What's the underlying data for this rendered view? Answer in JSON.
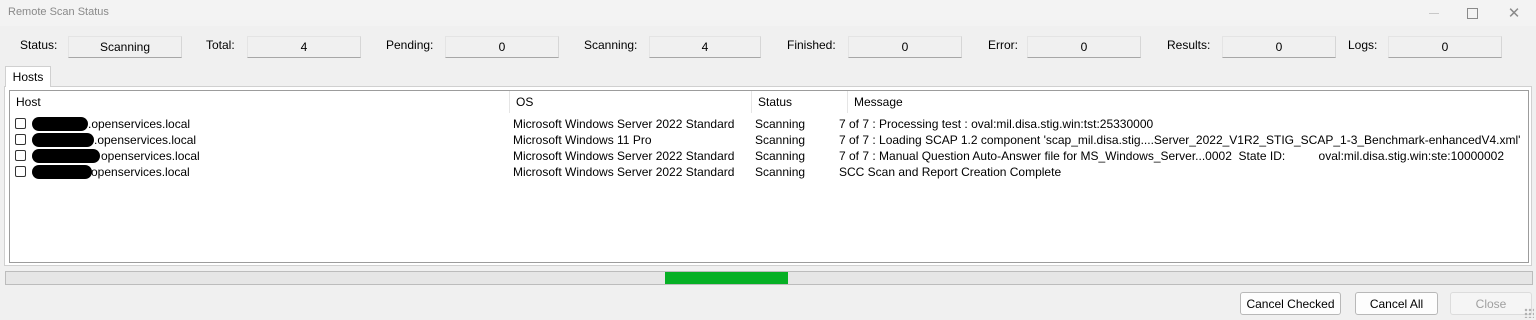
{
  "window": {
    "title": "Remote Scan Status",
    "controls": [
      "minimize-icon",
      "maximize-icon",
      "close-icon"
    ]
  },
  "stats": [
    {
      "label": "Status:",
      "value": "Scanning"
    },
    {
      "label": "Total:",
      "value": "4"
    },
    {
      "label": "Pending:",
      "value": "0"
    },
    {
      "label": "Scanning:",
      "value": "4"
    },
    {
      "label": "Finished:",
      "value": "0"
    },
    {
      "label": "Error:",
      "value": "0"
    },
    {
      "label": "Results:",
      "value": "0"
    },
    {
      "label": "Logs:",
      "value": "0"
    }
  ],
  "tab": {
    "label": "Hosts"
  },
  "table": {
    "headers": [
      "Host",
      "OS",
      "Status",
      "Message"
    ],
    "rows": [
      {
        "checked": false,
        "host": ".openservices.local",
        "os": "Microsoft Windows Server 2022 Standard",
        "status": "Scanning",
        "message": "7 of 7 : Processing test : oval:mil.disa.stig.win:tst:25330000"
      },
      {
        "checked": false,
        "host": ".openservices.local",
        "os": "Microsoft Windows 11 Pro",
        "status": "Scanning",
        "message": "7 of 7 : Loading SCAP 1.2 component 'scap_mil.disa.stig....Server_2022_V1R2_STIG_SCAP_1-3_Benchmark-enhancedV4.xml'"
      },
      {
        "checked": false,
        "host": "openservices.local",
        "os": "Microsoft Windows Server 2022 Standard",
        "status": "Scanning",
        "message": "7 of 7 : Manual Question Auto-Answer file for MS_Windows_Server...0002  State ID:          oval:mil.disa.stig.win:ste:10000002"
      },
      {
        "checked": false,
        "host": "openservices.local",
        "os": "Microsoft Windows Server 2022 Standard",
        "status": "Scanning",
        "message": "SCC Scan and Report Creation Complete"
      }
    ]
  },
  "progress": {
    "indeterminate": true,
    "color": "#06b025"
  },
  "buttons": {
    "cancel_checked": "Cancel Checked",
    "cancel_all": "Cancel All",
    "close": "Close"
  }
}
